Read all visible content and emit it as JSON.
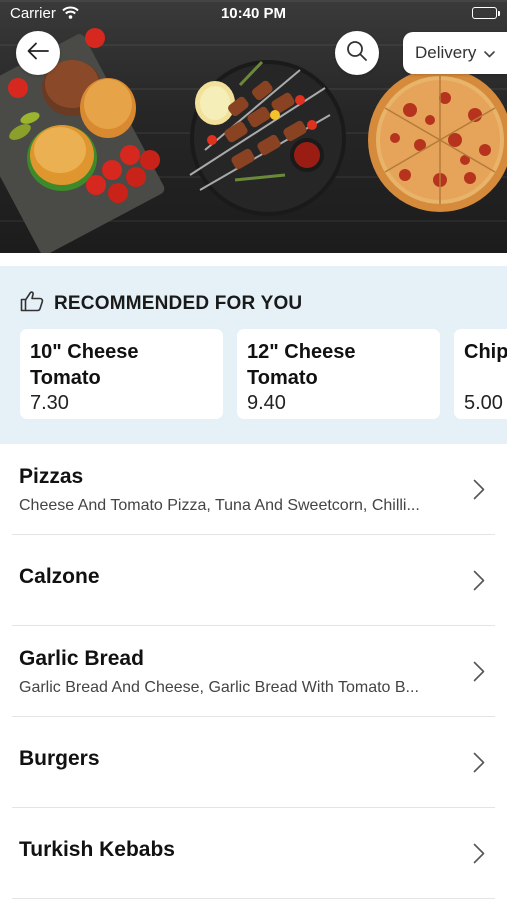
{
  "status_bar": {
    "carrier": "Carrier",
    "time": "10:40 PM"
  },
  "header": {
    "delivery_label": "Delivery"
  },
  "icons": {
    "back": "back-arrow-icon",
    "search": "search-icon",
    "dropdown": "chevron-down-icon",
    "thumbs_up": "thumbs-up-icon",
    "row": "chevron-right-icon"
  },
  "recommended": {
    "title": "RECOMMENDED FOR YOU",
    "items": [
      {
        "name": "10\" Cheese Tomato",
        "price": "7.30"
      },
      {
        "name": "12\" Cheese Tomato",
        "price": "9.40"
      },
      {
        "name": "Chip",
        "price": "5.00"
      }
    ]
  },
  "categories": [
    {
      "name": "Pizzas",
      "description": "Cheese And Tomato Pizza, Tuna And Sweetcorn, Chilli..."
    },
    {
      "name": "Calzone",
      "description": ""
    },
    {
      "name": "Garlic Bread",
      "description": "Garlic Bread And Cheese, Garlic Bread With Tomato B..."
    },
    {
      "name": "Burgers",
      "description": ""
    },
    {
      "name": "Turkish Kebabs",
      "description": ""
    }
  ],
  "colors": {
    "recommended_bg": "#e5f1f7",
    "card_bg": "#ffffff",
    "divider": "#e4e4e4"
  }
}
